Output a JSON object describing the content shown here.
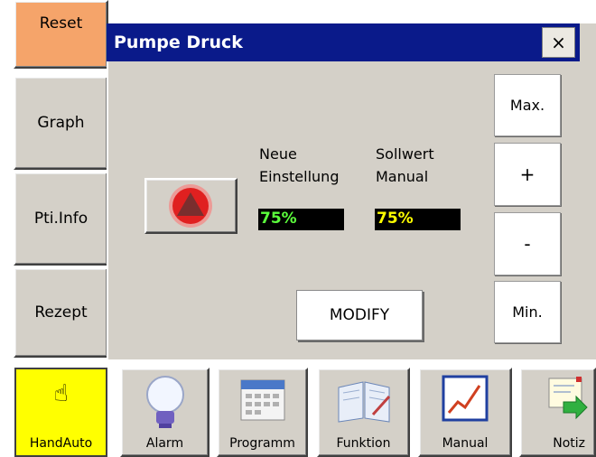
{
  "sidebar": {
    "reset": "Reset",
    "graph": "Graph",
    "pti_info": "Pti.Info",
    "rezept": "Rezept"
  },
  "dialog": {
    "title": "Pumpe Druck",
    "close": "×",
    "neue_einstellung": {
      "line1": "Neue",
      "line2": "Einstellung",
      "value": "75%"
    },
    "sollwert_manual": {
      "line1": "Sollwert",
      "line2": "Manual",
      "value": "75%"
    },
    "buttons": {
      "max": "Max.",
      "plus": "+",
      "minus": "-",
      "min": "Min.",
      "modify": "MODIFY"
    }
  },
  "toolbar": {
    "items": [
      "HandAuto",
      "Alarm",
      "Programm",
      "Funktion",
      "Manual",
      "Notiz"
    ]
  },
  "colors": {
    "reset_bg": "#f5a46a",
    "handauto_bg": "#ffff00",
    "titlebar": "#0a1a8a",
    "neue_value": "#5cff3c",
    "sollwert_value": "#ffff00",
    "pump_indicator": "#e02020"
  }
}
